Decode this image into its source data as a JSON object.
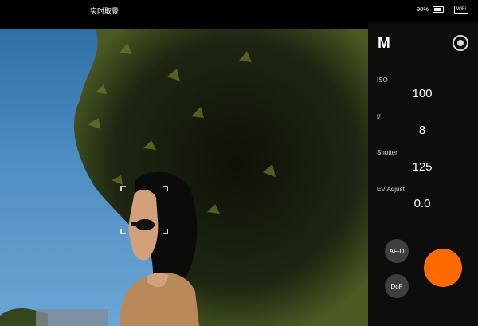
{
  "status_bar": {
    "title": "实时取景",
    "battery": "90%",
    "wifi": "WiFi"
  },
  "panel": {
    "mode": "M",
    "params": [
      {
        "label": "ISO",
        "value": "100"
      },
      {
        "label": "f/",
        "value": "8"
      },
      {
        "label": "Shutter",
        "value": "125"
      },
      {
        "label": "EV Adjust",
        "value": "0.0"
      }
    ],
    "buttons": {
      "af": "AF-D",
      "dof": "DoF"
    }
  },
  "colors": {
    "shutter": "#ff6a00",
    "panel": "#0d0d0d"
  }
}
